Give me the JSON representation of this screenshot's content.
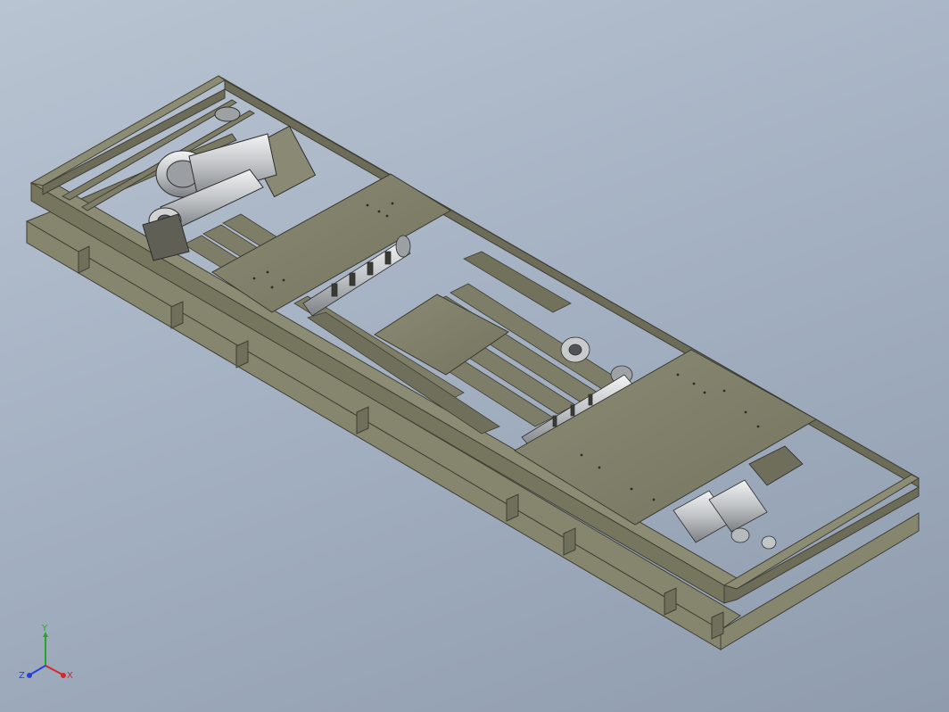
{
  "viewport": {
    "background_top": "#b9c4d2",
    "background_bottom": "#8f9cae"
  },
  "model": {
    "frame_color": "#8a8a72",
    "frame_dark": "#4e4e40",
    "plate_color": "#7e7e68",
    "metal_color": "#d4d6d8"
  },
  "triad": {
    "x_label": "X",
    "y_label": "Y",
    "z_label": "Z",
    "x_color": "#d12a2a",
    "y_color": "#2aa52a",
    "z_color": "#2a40d1"
  }
}
